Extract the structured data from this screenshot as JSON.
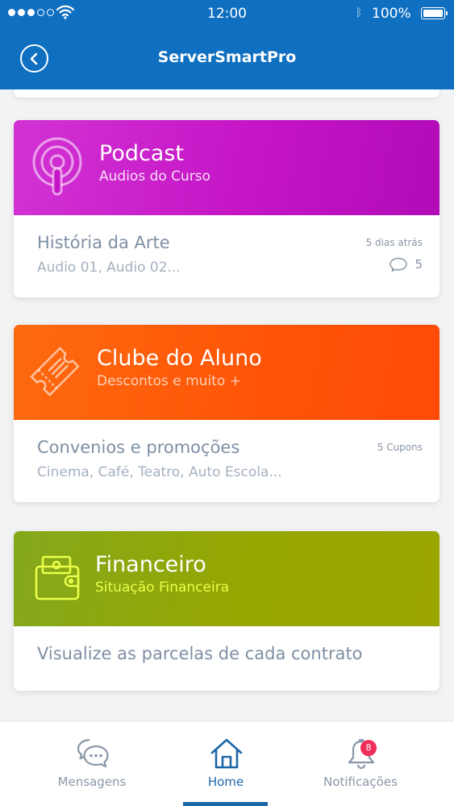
{
  "status_bar": {
    "time": "12:00",
    "battery_percent": "100%",
    "battery_level": 1.0
  },
  "header": {
    "title": "ServerSmartPro",
    "back_icon": "chevron-left-icon"
  },
  "cards": [
    {
      "title": "Podcast",
      "subtitle": "Audios do Curso",
      "icon": "podcast-icon",
      "item_title": "História da Arte",
      "item_subtitle": "Audio 01, Audio 02...",
      "meta": "5 dias atrás",
      "comments": "5",
      "color": "#c515c6"
    },
    {
      "title": "Clube do Aluno",
      "subtitle": "Descontos e muito +",
      "icon": "ticket-icon",
      "item_title": "Convenios e promoções",
      "item_subtitle": "Cinema, Café, Teatro, Auto Escola...",
      "meta": "5 Cupons",
      "color": "#ff5406"
    },
    {
      "title": "Financeiro",
      "subtitle": "Situação Financeira",
      "icon": "wallet-icon",
      "item_title": "Visualize as parcelas de cada contrato",
      "color": "#96a600"
    }
  ],
  "tabbar": {
    "tabs": [
      {
        "label": "Mensagens",
        "icon": "chat-icon"
      },
      {
        "label": "Home",
        "icon": "home-icon",
        "active": true
      },
      {
        "label": "Notificações",
        "icon": "bell-icon",
        "badge": "8"
      }
    ],
    "accent": "#1c67a8",
    "badge_color": "#ef2e5c"
  }
}
